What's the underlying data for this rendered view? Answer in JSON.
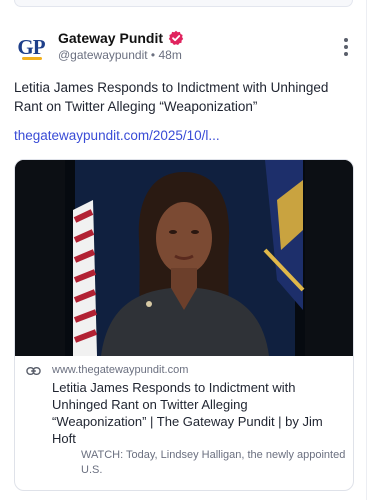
{
  "top_strip": "",
  "post": {
    "author_initials": "GP",
    "author_name": "Gateway Pundit",
    "handle": "@gatewaypundit",
    "separator": "•",
    "time_ago": "48m",
    "text": "Letitia James Responds to Indictment with Unhinged Rant on Twitter Alleging “Weaponization”",
    "link_text": "thegatewaypundit.com/2025/10/l...",
    "colors": {
      "brand_blue": "#1e3f8a",
      "brand_gold": "#f2b01e",
      "verified": "#e0245e",
      "link": "#3a4cd6"
    }
  },
  "card": {
    "domain": "www.thegatewaypundit.com",
    "title": "Letitia James Responds to Indictment with Unhinged Rant on Twitter Alleging “Weaponization” | The Gateway Pundit | by Jim Hoft",
    "description": "WATCH: Today, Lindsey Halligan, the newly appointed U.S.",
    "thumbnail_icon": "video-thumbnail-woman-at-podium"
  }
}
